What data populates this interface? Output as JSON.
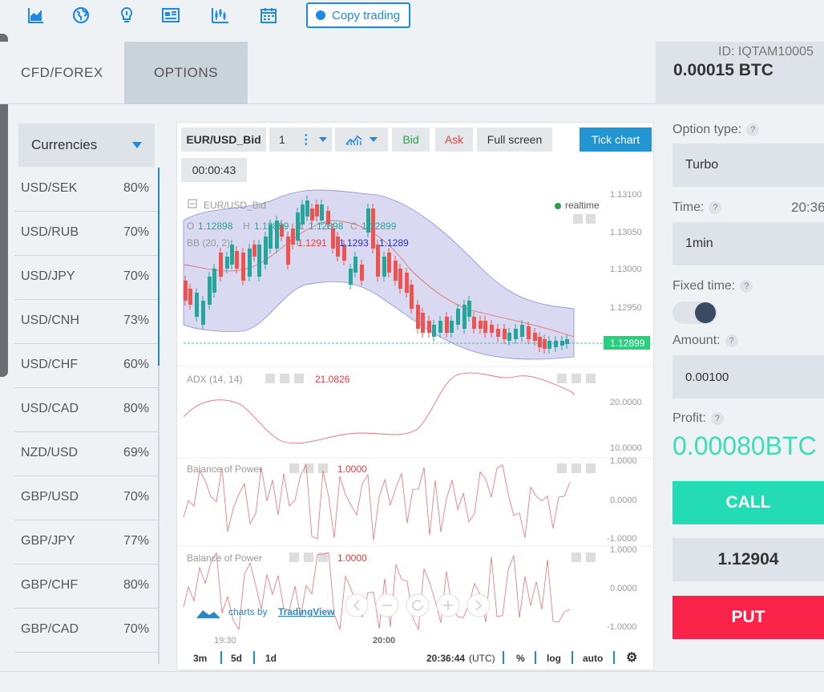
{
  "toolbar": {
    "icons": [
      "bar-chart-icon",
      "globe-icon",
      "lightbulb-icon",
      "news-icon",
      "candles-icon",
      "calendar-icon"
    ],
    "copy_trading_label": "Copy trading"
  },
  "tabs": [
    {
      "label": "CFD/FOREX"
    },
    {
      "label": "OPTIONS"
    }
  ],
  "account": {
    "id": "ID: IQTAM10005",
    "balance": "0.00015 BTC"
  },
  "assets": {
    "category": "Currencies",
    "items": [
      {
        "name": "USD/SEK",
        "payout": "80%"
      },
      {
        "name": "USD/RUB",
        "payout": "70%"
      },
      {
        "name": "USD/JPY",
        "payout": "70%"
      },
      {
        "name": "USD/CNH",
        "payout": "73%"
      },
      {
        "name": "USD/CHF",
        "payout": "60%"
      },
      {
        "name": "USD/CAD",
        "payout": "80%"
      },
      {
        "name": "NZD/USD",
        "payout": "69%"
      },
      {
        "name": "GBP/USD",
        "payout": "70%"
      },
      {
        "name": "GBP/JPY",
        "payout": "77%"
      },
      {
        "name": "GBP/CHF",
        "payout": "80%"
      },
      {
        "name": "GBP/CAD",
        "payout": "70%"
      }
    ]
  },
  "chart": {
    "symbol_button": "EUR/USD_Bid",
    "interval": "1",
    "bid_label": "Bid",
    "ask_label": "Ask",
    "fullscreen_label": "Full screen",
    "tick_chart_label": "Tick chart",
    "timer": "00:00:43",
    "main_title": "EUR/USD_Bid",
    "realtime": "realtime",
    "ohlc": {
      "o_label": "O",
      "o": "1.12898",
      "h_label": "H",
      "h": "1.12899",
      "l_label": "L",
      "l": "1.12898",
      "c_label": "C",
      "c": "1.12899"
    },
    "bb": {
      "label": "BB (20, 2)",
      "v1": "1.1291",
      "v2": "1.1293",
      "v3": "1.1289"
    },
    "price_ticks": [
      "1.13100",
      "1.13050",
      "1.13000",
      "1.12950"
    ],
    "last_price": "1.12899",
    "adx": {
      "label": "ADX (14, 14)",
      "value": "21.0826",
      "ticks": [
        "20.0000",
        "10.0000"
      ]
    },
    "bop1": {
      "label": "Balance of Power",
      "value": "1.0000",
      "ticks": [
        "1.0000",
        "0.0000",
        "-1.0000"
      ]
    },
    "bop2": {
      "label": "Balance of Power",
      "value": "1.0000",
      "ticks": [
        "1.0000",
        "0.0000",
        "-1.0000"
      ]
    },
    "time_ticks": [
      "19:30",
      "20:00"
    ],
    "branding_prefix": "charts by",
    "branding_name": "TradingView",
    "footer": {
      "r3m": "3m",
      "r5d": "5d",
      "r1d": "1d",
      "clock": "20:36:44",
      "tz": "(UTC)",
      "pct": "%",
      "log": "log",
      "auto": "auto"
    }
  },
  "option_panel": {
    "option_type_label": "Option type:",
    "option_type_value": "Turbo",
    "time_label": "Time:",
    "time_value": "20:36",
    "duration": "1min",
    "fixed_time_label": "Fixed time:",
    "amount_label": "Amount:",
    "amount_value": "0.00100",
    "profit_label": "Profit:",
    "profit_value": "0.00080BTC",
    "call_label": "CALL",
    "current_price": "1.12904",
    "put_label": "PUT",
    "help": "?"
  },
  "colors": {
    "accent": "#1e88e5",
    "call": "#23dcb5",
    "put": "#f9234a",
    "bull_candle": "#26a69a",
    "bear_candle": "#ef5350",
    "bb_fill": "#d7d8f0"
  }
}
